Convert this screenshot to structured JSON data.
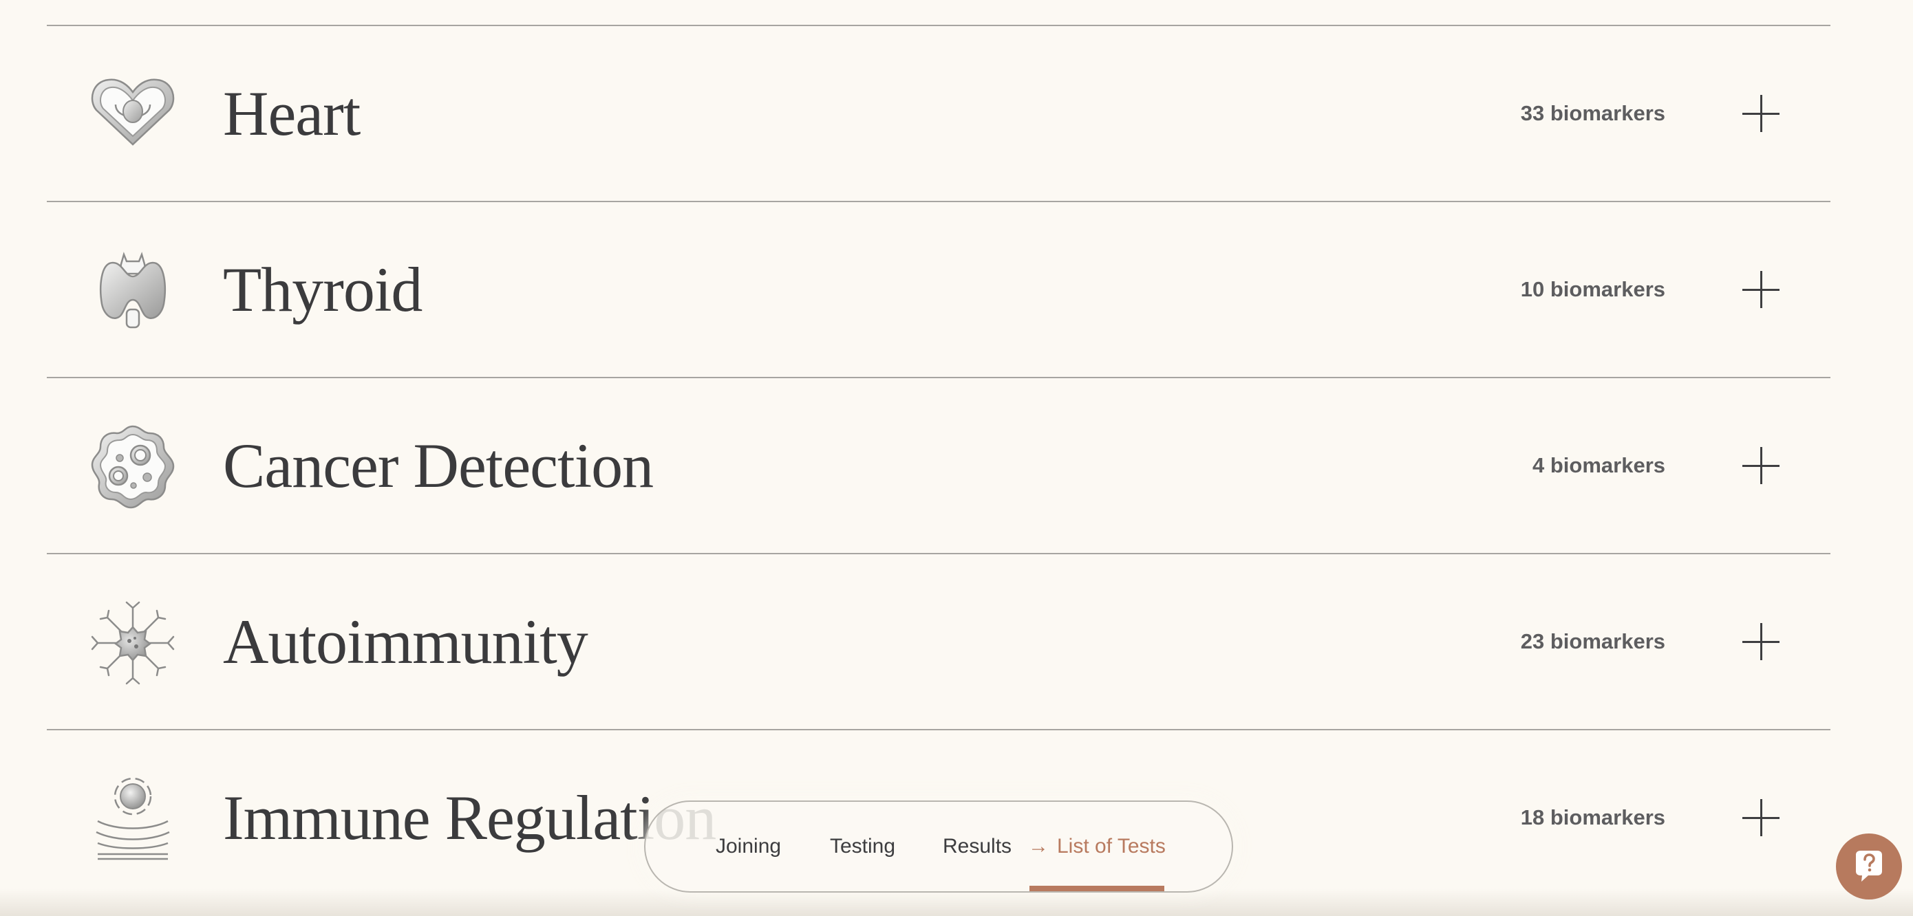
{
  "categories": [
    {
      "title": "Heart",
      "count": "33 biomarkers",
      "icon": "heart-icon"
    },
    {
      "title": "Thyroid",
      "count": "10 biomarkers",
      "icon": "thyroid-icon"
    },
    {
      "title": "Cancer Detection",
      "count": "4 biomarkers",
      "icon": "cell-icon"
    },
    {
      "title": "Autoimmunity",
      "count": "23 biomarkers",
      "icon": "antibody-icon"
    },
    {
      "title": "Immune Regulation",
      "count": "18 biomarkers",
      "icon": "immune-shield-icon"
    }
  ],
  "nav": {
    "items": [
      "Joining",
      "Testing",
      "Results"
    ],
    "active": "List of Tests",
    "active_arrow": "→"
  },
  "colors": {
    "background": "#fcf9f3",
    "accent": "#b87a5f",
    "text": "#3b3b3d",
    "divider": "#a7a5a1"
  },
  "help": {
    "icon": "question-icon"
  }
}
